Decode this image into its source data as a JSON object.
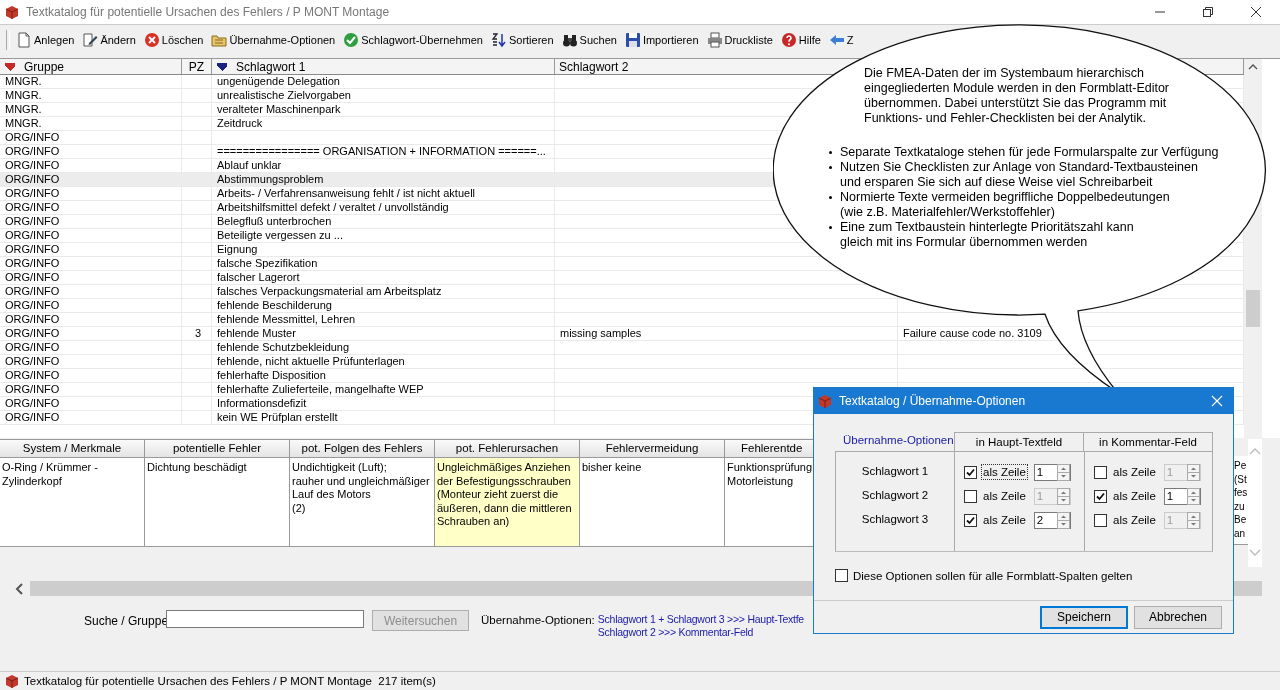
{
  "window": {
    "title": "Textkatalog für potentielle Ursachen des Fehlers / P MONT Montage"
  },
  "toolbar": [
    {
      "label": "Anlegen"
    },
    {
      "label": "Ändern"
    },
    {
      "label": "Löschen"
    },
    {
      "label": "Übernahme-Optionen"
    },
    {
      "label": "Schlagwort-Übernehmen"
    },
    {
      "label": "Sortieren"
    },
    {
      "label": "Suchen"
    },
    {
      "label": "Importieren"
    },
    {
      "label": "Druckliste"
    },
    {
      "label": "Hilfe"
    },
    {
      "label": "Z"
    }
  ],
  "table": {
    "columns": [
      {
        "label": "Gruppe",
        "sorted": true,
        "color": "#c62828"
      },
      {
        "label": "PZ",
        "sorted": false
      },
      {
        "label": "Schlagwort 1",
        "sorted": true,
        "color": "#1a237e"
      },
      {
        "label": "Schlagwort 2",
        "sorted": false
      }
    ],
    "rows": [
      {
        "gruppe": "MNGR.",
        "schlagwort_1": "ungenügende Delegation",
        "selected": false
      },
      {
        "gruppe": "MNGR.",
        "schlagwort_1": "unrealistische Zielvorgaben",
        "selected": false
      },
      {
        "gruppe": "MNGR.",
        "schlagwort_1": "veralteter Maschinenpark",
        "selected": false
      },
      {
        "gruppe": "MNGR.",
        "schlagwort_1": "Zeitdruck",
        "selected": false
      },
      {
        "gruppe": "ORG/INFO",
        "selected": false
      },
      {
        "gruppe": "ORG/INFO",
        "schlagwort_1": "================  ORGANISATION + INFORMATION  ======...",
        "selected": false
      },
      {
        "gruppe": "ORG/INFO",
        "schlagwort_1": "Ablauf unklar",
        "selected": false
      },
      {
        "gruppe": "ORG/INFO",
        "schlagwort_1": "Abstimmungsproblem",
        "selected": true
      },
      {
        "gruppe": "ORG/INFO",
        "schlagwort_1": "Arbeits- / Verfahrensanweisung  fehlt / ist nicht aktuell",
        "selected": false
      },
      {
        "gruppe": "ORG/INFO",
        "schlagwort_1": "Arbeitshilfsmittel  defekt / veraltet / unvollständig",
        "selected": false
      },
      {
        "gruppe": "ORG/INFO",
        "schlagwort_1": "Belegfluß unterbrochen",
        "selected": false
      },
      {
        "gruppe": "ORG/INFO",
        "schlagwort_1": "Beteiligte vergessen zu ...",
        "selected": false
      },
      {
        "gruppe": "ORG/INFO",
        "schlagwort_1": "Eignung",
        "selected": false
      },
      {
        "gruppe": "ORG/INFO",
        "schlagwort_1": "falsche Spezifikation",
        "selected": false
      },
      {
        "gruppe": "ORG/INFO",
        "schlagwort_1": "falscher Lagerort",
        "selected": false
      },
      {
        "gruppe": "ORG/INFO",
        "schlagwort_1": "falsches Verpackungsmaterial am Arbeitsplatz",
        "selected": false
      },
      {
        "gruppe": "ORG/INFO",
        "schlagwort_1": "fehlende Beschilderung",
        "selected": false
      },
      {
        "gruppe": "ORG/INFO",
        "schlagwort_1": "fehlende Messmittel, Lehren",
        "selected": false
      },
      {
        "gruppe": "ORG/INFO",
        "pz": "3",
        "schlagwort_1": "fehlende Muster",
        "schlagwort_2": "missing samples",
        "column_5": "Failure cause code no. 3109",
        "selected": false
      },
      {
        "gruppe": "ORG/INFO",
        "schlagwort_1": "fehlende Schutzbekleidung",
        "selected": false
      },
      {
        "gruppe": "ORG/INFO",
        "schlagwort_1": "fehlende, nicht aktuelle Prüfunterlagen",
        "selected": false
      },
      {
        "gruppe": "ORG/INFO",
        "schlagwort_1": "fehlerhafte Disposition",
        "selected": false
      },
      {
        "gruppe": "ORG/INFO",
        "schlagwort_1": "fehlerhafte Zulieferteile, mangelhafte WEP",
        "selected": false
      },
      {
        "gruppe": "ORG/INFO",
        "schlagwort_1": "Informationsdefizit",
        "selected": false
      },
      {
        "gruppe": "ORG/INFO",
        "schlagwort_1": "kein WE Prüfplan erstellt",
        "selected": false
      }
    ]
  },
  "callout": {
    "text": "Die FMEA-Daten der im Systembaum hierarchisch\neingegliederten Module werden in den Formblatt-Editor\nübernommen. Dabei unterstützt Sie das Programm mit\nFunktions- und Fehler-Checklisten bei der Analytik.",
    "bullets": [
      "Separate Textkataloge stehen für jede Formularspalte zur Verfügung",
      "Nutzen Sie Checklisten zur Anlage von Standard-Textbausteinen\nund ersparen Sie sich auf diese Weise viel Schreibarbeit",
      "Normierte Texte vermeiden begriffliche Doppelbedeutungen\n(wie z.B. Materialfehler/Werkstoffehler)",
      "Eine zum Textbaustein hinterlegte Prioritätszahl kann\ngleich mit ins Formular übernommen werden"
    ]
  },
  "form": {
    "columns": [
      {
        "header": "System / Merkmale",
        "text": "O-Ring / Krümmer -\nZylinderkopf",
        "selected": false
      },
      {
        "header": "potentielle Fehler",
        "text": "Dichtung beschädigt",
        "selected": false
      },
      {
        "header": "pot. Folgen des Fehlers",
        "text": "Undichtigkeit (Luft);\nrauher und ungleichmäßiger\nLauf des Motors\n(2)",
        "selected": false
      },
      {
        "header": "pot. Fehlerursachen",
        "text": "Ungleichmäßiges Anziehen\nder Befestigungsschrauben\n(Monteur zieht zuerst die\näußeren, dann die mittleren\nSchrauben an)",
        "selected": true
      },
      {
        "header": "Fehlervermeidung",
        "text": "bisher keine",
        "selected": false
      },
      {
        "header": "Fehlerentde",
        "text": "Funktionsprüfung\nMotorleistung",
        "selected": false
      }
    ],
    "partial_column": {
      "text": "Pe\n(St\nfes\nzu\nBe\nan"
    }
  },
  "search": {
    "label": "Suche / Gruppe",
    "button": {
      "label": "Weitersuchen",
      "disabled": true
    },
    "options_label": "Übernahme-Optionen:",
    "options_lines": [
      "Schlagwort 1 + Schlagwort 3 >>> Haupt-Textfe",
      "Schlagwort 2 >>> Kommentar-Feld"
    ]
  },
  "status_bar": {
    "text": "Textkatalog für potentielle Ursachen des Fehlers / P MONT Montage  217 item(s)"
  },
  "dialog": {
    "title": "Textkatalog / Übernahme-Optionen",
    "group_label": "Übernahme-Optionen",
    "headers": [
      "in Haupt-Textfeld",
      "in Kommentar-Feld"
    ],
    "rows": [
      {
        "label": "Schlagwort 1",
        "options": [
          {
            "label": "als Zeile",
            "checked": true,
            "focused": true,
            "value": "1"
          },
          {
            "label": "als Zeile",
            "checked": false,
            "focused": false,
            "value": "1"
          }
        ]
      },
      {
        "label": "Schlagwort 2",
        "options": [
          {
            "label": "als Zeile",
            "checked": false,
            "focused": false,
            "value": "1"
          },
          {
            "label": "als Zeile",
            "checked": true,
            "focused": false,
            "value": "1"
          }
        ]
      },
      {
        "label": "Schlagwort 3",
        "options": [
          {
            "label": "als Zeile",
            "checked": true,
            "focused": false,
            "value": "2"
          },
          {
            "label": "als Zeile",
            "checked": false,
            "focused": false,
            "value": "1"
          }
        ]
      }
    ],
    "all_columns": {
      "label": "Diese Optionen sollen für alle Formblatt-Spalten gelten",
      "checked": false
    },
    "buttons": [
      {
        "label": "Speichern",
        "default": true
      },
      {
        "label": "Abbrechen",
        "default": false
      }
    ]
  }
}
